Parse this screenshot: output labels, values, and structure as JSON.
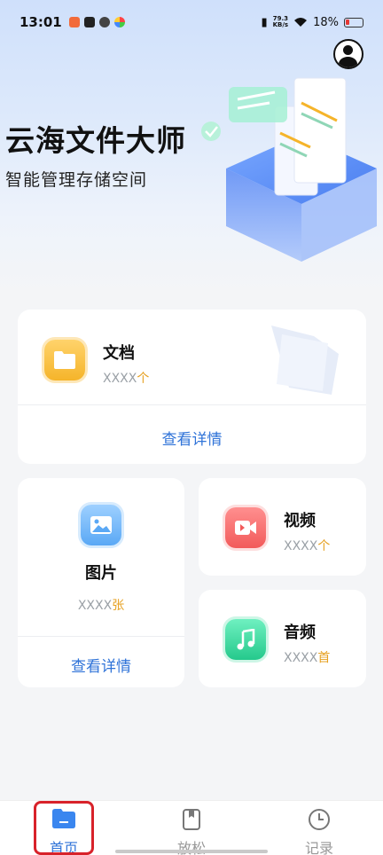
{
  "status_bar": {
    "time": "13:01",
    "net_speed_value": "79.3",
    "net_speed_unit": "KB/s",
    "battery": "18%"
  },
  "header": {
    "title": "云海文件大师",
    "subtitle": "智能管理存储空间"
  },
  "categories": {
    "documents": {
      "name": "文档",
      "count": "XXXX",
      "unit": "个",
      "detail_label": "查看详情",
      "icon": "folder-icon"
    },
    "pictures": {
      "name": "图片",
      "count": "XXXX",
      "unit": "张",
      "detail_label": "查看详情",
      "icon": "image-icon"
    },
    "videos": {
      "name": "视频",
      "count": "XXXX",
      "unit": "个",
      "icon": "video-camera-icon"
    },
    "audio": {
      "name": "音频",
      "count": "XXXX",
      "unit": "首",
      "icon": "music-note-icon"
    }
  },
  "bottom_nav": {
    "items": [
      {
        "label": "首页",
        "icon": "folder-icon",
        "active": true
      },
      {
        "label": "放松",
        "icon": "bookmark-book-icon",
        "active": false
      },
      {
        "label": "记录",
        "icon": "clock-icon",
        "active": false
      }
    ]
  },
  "colors": {
    "accent": "#2f73d8",
    "count_unit": "#e6a020",
    "highlight_box": "#d8222a"
  }
}
